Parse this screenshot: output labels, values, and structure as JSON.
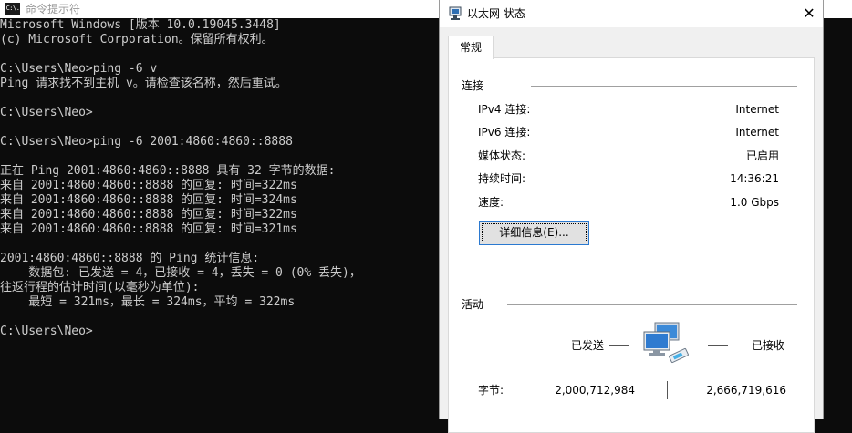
{
  "cmd": {
    "title": "命令提示符",
    "icon_label": "C:\\.",
    "lines": [
      "Microsoft Windows [版本 10.0.19045.3448]",
      "(c) Microsoft Corporation。保留所有权利。",
      "",
      "C:\\Users\\Neo>ping -6 v",
      "Ping 请求找不到主机 v。请检查该名称，然后重试。",
      "",
      "C:\\Users\\Neo>",
      "",
      "C:\\Users\\Neo>ping -6 2001:4860:4860::8888",
      "",
      "正在 Ping 2001:4860:4860::8888 具有 32 字节的数据:",
      "来自 2001:4860:4860::8888 的回复: 时间=322ms",
      "来自 2001:4860:4860::8888 的回复: 时间=324ms",
      "来自 2001:4860:4860::8888 的回复: 时间=322ms",
      "来自 2001:4860:4860::8888 的回复: 时间=321ms",
      "",
      "2001:4860:4860::8888 的 Ping 统计信息:",
      "    数据包: 已发送 = 4，已接收 = 4，丢失 = 0 (0% 丢失)，",
      "往返行程的估计时间(以毫秒为单位):",
      "    最短 = 321ms，最长 = 324ms，平均 = 322ms",
      "",
      "C:\\Users\\Neo>"
    ]
  },
  "dialog": {
    "title": "以太网 状态",
    "close_glyph": "✕",
    "tab_label": "常规",
    "connection": {
      "group_label": "连接",
      "rows": [
        {
          "label": "IPv4 连接:",
          "value": "Internet"
        },
        {
          "label": "IPv6 连接:",
          "value": "Internet"
        },
        {
          "label": "媒体状态:",
          "value": "已启用"
        },
        {
          "label": "持续时间:",
          "value": "14:36:21"
        },
        {
          "label": "速度:",
          "value": "1.0 Gbps"
        }
      ],
      "details_button": "详细信息(E)..."
    },
    "activity": {
      "group_label": "活动",
      "sent_label": "已发送",
      "received_label": "已接收",
      "bytes_label": "字节:",
      "bytes_sent": "2,000,712,984",
      "bytes_received": "2,666,719,616",
      "icon": "network-computers-icon"
    }
  }
}
